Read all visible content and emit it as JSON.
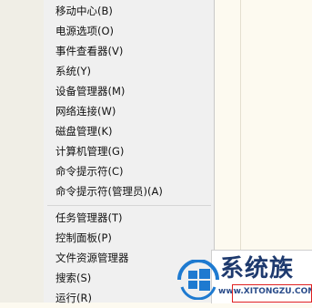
{
  "menu": {
    "group1": [
      {
        "label": "移动中心(B)"
      },
      {
        "label": "电源选项(O)"
      },
      {
        "label": "事件查看器(V)"
      },
      {
        "label": "系统(Y)"
      },
      {
        "label": "设备管理器(M)"
      },
      {
        "label": "网络连接(W)"
      },
      {
        "label": "磁盘管理(K)"
      },
      {
        "label": "计算机管理(G)"
      },
      {
        "label": "命令提示符(C)"
      },
      {
        "label": "命令提示符(管理员)(A)"
      }
    ],
    "group2": [
      {
        "label": "任务管理器(T)"
      },
      {
        "label": "控制面板(P)"
      },
      {
        "label": "文件资源管理器"
      },
      {
        "label": "搜索(S)"
      },
      {
        "label": "运行(R)"
      }
    ]
  },
  "watermark": {
    "title": "系统族",
    "url": "www.XITONGZU.COM"
  },
  "colors": {
    "menu_bg": "#f0f0f0",
    "page_bg": "#fdfaf0",
    "highlight_box": "#e02020",
    "logo_blue": "#1e7ad0"
  }
}
